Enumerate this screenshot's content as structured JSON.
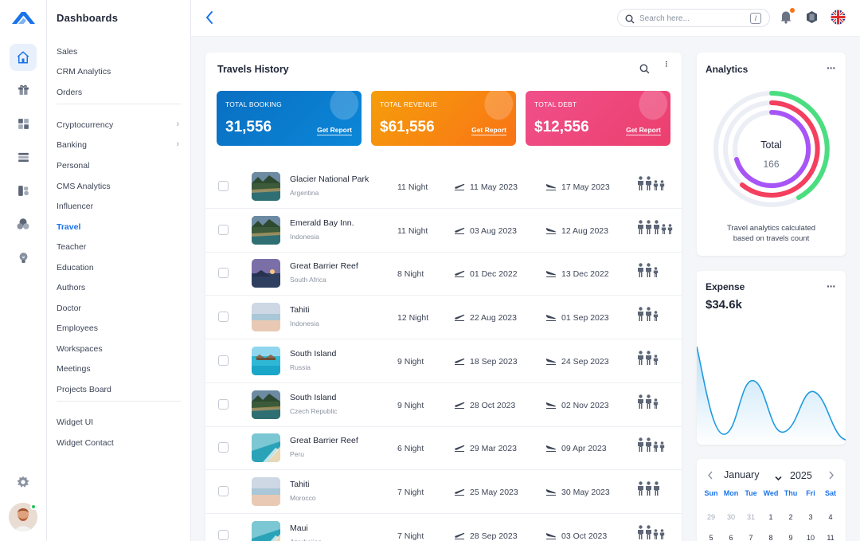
{
  "brand": {
    "accent": "#1a73e8"
  },
  "rail": {
    "icons": [
      "logo-icon",
      "home-icon",
      "gift-icon",
      "widgets-icon",
      "layers-icon",
      "clipboard-icon",
      "users-icon",
      "bulb-icon",
      "settings-icon"
    ]
  },
  "sidebar": {
    "title": "Dashboards",
    "groups": [
      [
        {
          "label": "Sales"
        },
        {
          "label": "CRM Analytics"
        },
        {
          "label": "Orders"
        }
      ],
      [
        {
          "label": "Cryptocurrency",
          "chevron": true
        },
        {
          "label": "Banking",
          "chevron": true
        },
        {
          "label": "Personal"
        },
        {
          "label": "CMS Analytics"
        },
        {
          "label": "Influencer"
        },
        {
          "label": "Travel",
          "active": true
        },
        {
          "label": "Teacher"
        },
        {
          "label": "Education"
        },
        {
          "label": "Authors"
        },
        {
          "label": "Doctor"
        },
        {
          "label": "Employees"
        },
        {
          "label": "Workspaces"
        },
        {
          "label": "Meetings"
        },
        {
          "label": "Projects Board"
        }
      ],
      [
        {
          "label": "Widget UI"
        },
        {
          "label": "Widget Contact"
        }
      ]
    ]
  },
  "topbar": {
    "search_placeholder": "Search here...",
    "search_shortcut": "/"
  },
  "travels": {
    "title": "Travels History",
    "stats": [
      {
        "label": "TOTAL BOOKING",
        "value": "31,556",
        "action": "Get Report",
        "color": "#0a73c4"
      },
      {
        "label": "TOTAL REVENUE",
        "value": "$61,556",
        "action": "Get Report",
        "color": "#f5860f"
      },
      {
        "label": "TOTAL DEBT",
        "value": "$12,556",
        "action": "Get Report",
        "color": "#ef3f7a"
      }
    ],
    "rows": [
      {
        "name": "Glacier National Park",
        "country": "Argentina",
        "nights": "11 Night",
        "departure": "11 May 2023",
        "arrival": "17 May 2023",
        "adults": 2,
        "children": 2,
        "thumb": "forest"
      },
      {
        "name": "Emerald Bay Inn.",
        "country": "Indonesia",
        "nights": "11 Night",
        "departure": "03 Aug 2023",
        "arrival": "12 Aug 2023",
        "adults": 3,
        "children": 2,
        "thumb": "forest"
      },
      {
        "name": "Great Barrier Reef",
        "country": "South Africa",
        "nights": "8 Night",
        "departure": "01 Dec 2022",
        "arrival": "13 Dec 2022",
        "adults": 2,
        "children": 1,
        "thumb": "dusk"
      },
      {
        "name": "Tahiti",
        "country": "Indonesia",
        "nights": "12 Night",
        "departure": "22 Aug 2023",
        "arrival": "01 Sep 2023",
        "adults": 2,
        "children": 1,
        "thumb": "beach"
      },
      {
        "name": "South Island",
        "country": "Russia",
        "nights": "9 Night",
        "departure": "18 Sep 2023",
        "arrival": "24 Sep 2023",
        "adults": 2,
        "children": 1,
        "thumb": "lagoon"
      },
      {
        "name": "South Island",
        "country": "Czech Republic",
        "nights": "9 Night",
        "departure": "28 Oct 2023",
        "arrival": "02 Nov 2023",
        "adults": 2,
        "children": 1,
        "thumb": "forest"
      },
      {
        "name": "Great Barrier Reef",
        "country": "Peru",
        "nights": "6 Night",
        "departure": "29 Mar 2023",
        "arrival": "09 Apr 2023",
        "adults": 2,
        "children": 2,
        "thumb": "coast"
      },
      {
        "name": "Tahiti",
        "country": "Morocco",
        "nights": "7 Night",
        "departure": "25 May 2023",
        "arrival": "30 May 2023",
        "adults": 3,
        "children": 0,
        "thumb": "beach"
      },
      {
        "name": "Maui",
        "country": "Azerbaijan",
        "nights": "7 Night",
        "departure": "28 Sep 2023",
        "arrival": "03 Oct 2023",
        "adults": 2,
        "children": 2,
        "thumb": "coast"
      }
    ]
  },
  "analytics": {
    "title": "Analytics",
    "center_label": "Total",
    "center_value": "166",
    "caption": "Travel analytics calculated based on travels count"
  },
  "expense": {
    "title": "Expense",
    "value": "$34.6k"
  },
  "calendar": {
    "month": "January",
    "year": "2025",
    "weekdays": [
      "Sun",
      "Mon",
      "Tue",
      "Wed",
      "Thu",
      "Fri",
      "Sat"
    ],
    "rows": [
      [
        "29",
        "30",
        "31",
        "1",
        "2",
        "3",
        "4"
      ],
      [
        "5",
        "6",
        "7",
        "8",
        "9",
        "10",
        "11"
      ]
    ],
    "muted_first": 3
  }
}
